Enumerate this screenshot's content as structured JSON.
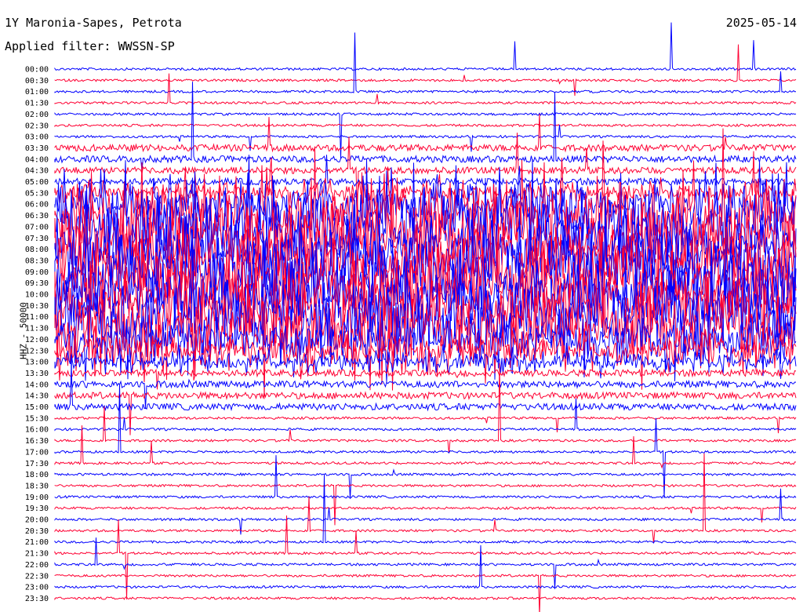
{
  "header": {
    "station": "1Y Maronia-Sapes, Petrota",
    "date": "2025-05-14",
    "filter": "Applied filter: WWSSN-SP"
  },
  "channel_label": "HHZ - 50000",
  "colors": {
    "trace_a": "#0000ff",
    "trace_b": "#ff0033",
    "text": "#000000",
    "background": "#ffffff"
  },
  "chart_data": {
    "type": "line",
    "title": "1Y Maronia-Sapes, Petrota",
    "ylabel": "HHZ - 50000",
    "rows": [
      "00:00",
      "00:30",
      "01:00",
      "01:30",
      "02:00",
      "02:30",
      "03:00",
      "03:30",
      "04:00",
      "04:30",
      "05:00",
      "05:30",
      "06:00",
      "06:30",
      "07:00",
      "07:30",
      "08:00",
      "08:30",
      "09:00",
      "09:30",
      "10:00",
      "10:30",
      "11:00",
      "11:30",
      "12:00",
      "12:30",
      "13:00",
      "13:30",
      "14:00",
      "14:30",
      "15:00",
      "15:30",
      "16:00",
      "16:30",
      "17:00",
      "17:30",
      "18:00",
      "18:30",
      "19:00",
      "19:30",
      "20:00",
      "20:30",
      "21:00",
      "21:30",
      "22:00",
      "22:30",
      "23:00",
      "23:30"
    ],
    "x_range_minutes": [
      0,
      30
    ],
    "row_activity": [
      1,
      1,
      1,
      1,
      1,
      1,
      1,
      2,
      2,
      2,
      2,
      3,
      5,
      6,
      6,
      6,
      6,
      6,
      6,
      6,
      6,
      6,
      6,
      6,
      5,
      4,
      3,
      2,
      2,
      2,
      2,
      1,
      1,
      1,
      1,
      1,
      1,
      1,
      1,
      1,
      1,
      1,
      1,
      1,
      1,
      1,
      1,
      1
    ]
  }
}
